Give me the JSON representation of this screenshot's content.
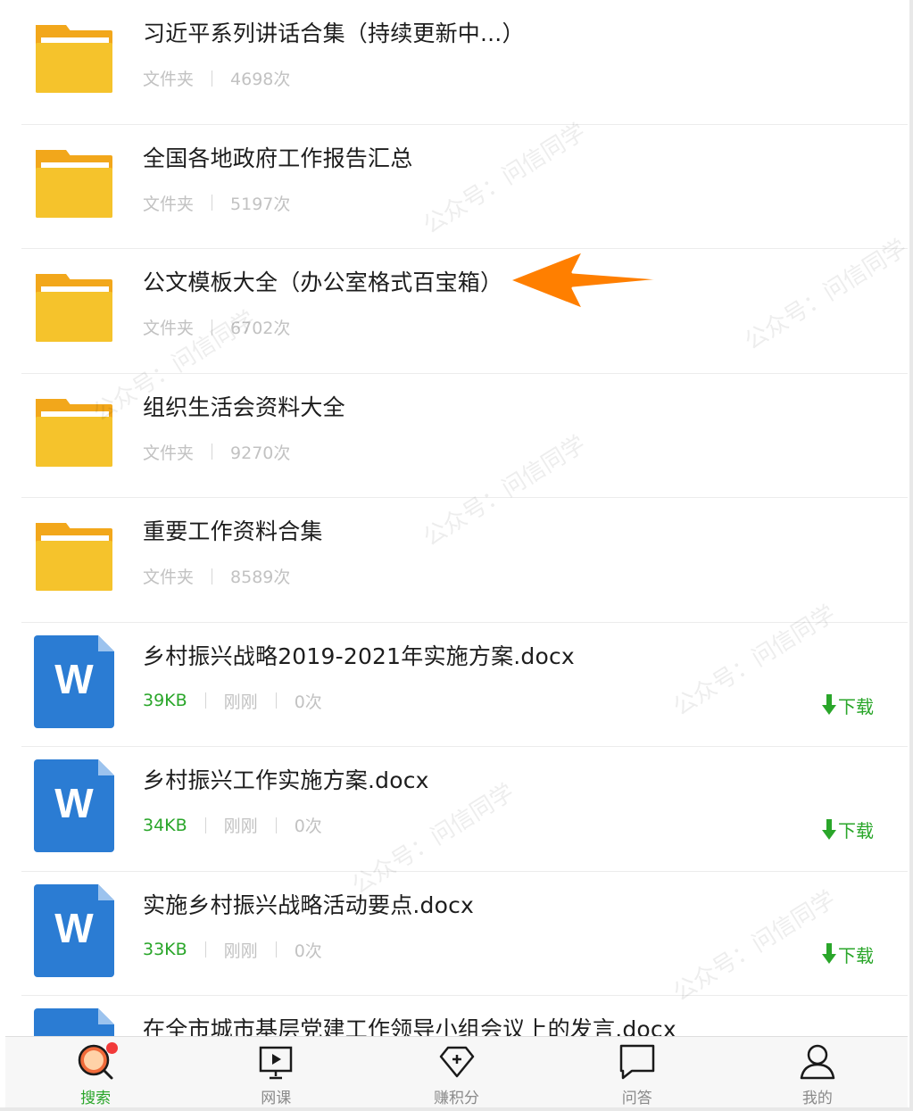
{
  "items": [
    {
      "type": "folder",
      "title": "习近平系列讲话合集（持续更新中...）",
      "kind": "文件夹",
      "count": "4698次"
    },
    {
      "type": "folder",
      "title": "全国各地政府工作报告汇总",
      "kind": "文件夹",
      "count": "5197次"
    },
    {
      "type": "folder",
      "title": "公文模板大全（办公室格式百宝箱）",
      "kind": "文件夹",
      "count": "6702次"
    },
    {
      "type": "folder",
      "title": "组织生活会资料大全",
      "kind": "文件夹",
      "count": "9270次"
    },
    {
      "type": "folder",
      "title": "重要工作资料合集",
      "kind": "文件夹",
      "count": "8589次"
    },
    {
      "type": "doc",
      "title": "乡村振兴战略2019-2021年实施方案.docx",
      "size": "39KB",
      "time": "刚刚",
      "count": "0次",
      "download": "下载"
    },
    {
      "type": "doc",
      "title": "乡村振兴工作实施方案.docx",
      "size": "34KB",
      "time": "刚刚",
      "count": "0次",
      "download": "下载"
    },
    {
      "type": "doc",
      "title": "实施乡村振兴战略活动要点.docx",
      "size": "33KB",
      "time": "刚刚",
      "count": "0次",
      "download": "下载"
    },
    {
      "type": "doc",
      "title": "在全市城市基层党建工作领导小组会议上的发言.docx"
    }
  ],
  "word_icon_letter": "W",
  "tabs": [
    {
      "label": "搜索",
      "icon": "search-icon",
      "active": true
    },
    {
      "label": "网课",
      "icon": "video-lesson-icon"
    },
    {
      "label": "赚积分",
      "icon": "points-diamond-icon"
    },
    {
      "label": "问答",
      "icon": "chat-bubble-icon"
    },
    {
      "label": "我的",
      "icon": "user-icon"
    }
  ],
  "watermark": "公众号：问信同学",
  "colors": {
    "accent": "#2aa62a",
    "folder": "#f5c32c",
    "word": "#2b7cd3",
    "arrow": "#ff7f00",
    "badge": "#f23a3a"
  }
}
